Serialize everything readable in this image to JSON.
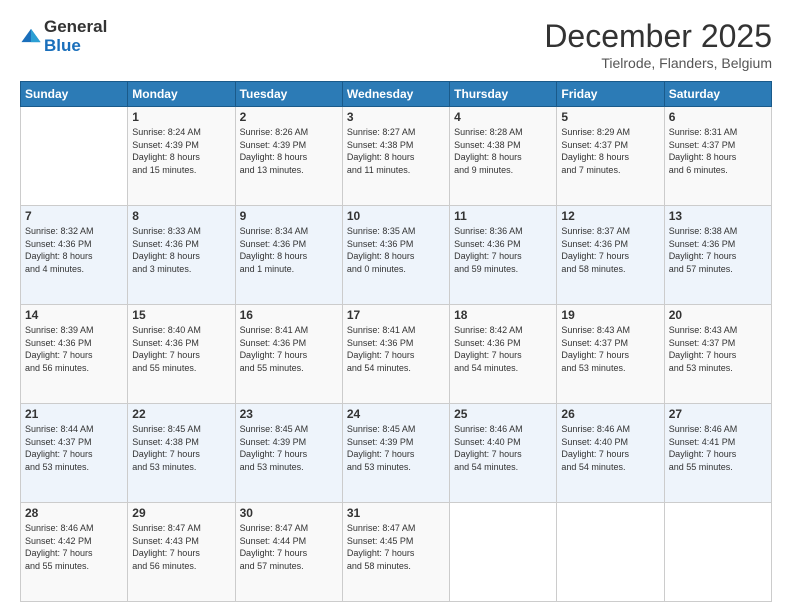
{
  "logo": {
    "general": "General",
    "blue": "Blue"
  },
  "header": {
    "month": "December 2025",
    "location": "Tielrode, Flanders, Belgium"
  },
  "days_of_week": [
    "Sunday",
    "Monday",
    "Tuesday",
    "Wednesday",
    "Thursday",
    "Friday",
    "Saturday"
  ],
  "weeks": [
    [
      {
        "day": "",
        "info": ""
      },
      {
        "day": "1",
        "info": "Sunrise: 8:24 AM\nSunset: 4:39 PM\nDaylight: 8 hours\nand 15 minutes."
      },
      {
        "day": "2",
        "info": "Sunrise: 8:26 AM\nSunset: 4:39 PM\nDaylight: 8 hours\nand 13 minutes."
      },
      {
        "day": "3",
        "info": "Sunrise: 8:27 AM\nSunset: 4:38 PM\nDaylight: 8 hours\nand 11 minutes."
      },
      {
        "day": "4",
        "info": "Sunrise: 8:28 AM\nSunset: 4:38 PM\nDaylight: 8 hours\nand 9 minutes."
      },
      {
        "day": "5",
        "info": "Sunrise: 8:29 AM\nSunset: 4:37 PM\nDaylight: 8 hours\nand 7 minutes."
      },
      {
        "day": "6",
        "info": "Sunrise: 8:31 AM\nSunset: 4:37 PM\nDaylight: 8 hours\nand 6 minutes."
      }
    ],
    [
      {
        "day": "7",
        "info": "Sunrise: 8:32 AM\nSunset: 4:36 PM\nDaylight: 8 hours\nand 4 minutes."
      },
      {
        "day": "8",
        "info": "Sunrise: 8:33 AM\nSunset: 4:36 PM\nDaylight: 8 hours\nand 3 minutes."
      },
      {
        "day": "9",
        "info": "Sunrise: 8:34 AM\nSunset: 4:36 PM\nDaylight: 8 hours\nand 1 minute."
      },
      {
        "day": "10",
        "info": "Sunrise: 8:35 AM\nSunset: 4:36 PM\nDaylight: 8 hours\nand 0 minutes."
      },
      {
        "day": "11",
        "info": "Sunrise: 8:36 AM\nSunset: 4:36 PM\nDaylight: 7 hours\nand 59 minutes."
      },
      {
        "day": "12",
        "info": "Sunrise: 8:37 AM\nSunset: 4:36 PM\nDaylight: 7 hours\nand 58 minutes."
      },
      {
        "day": "13",
        "info": "Sunrise: 8:38 AM\nSunset: 4:36 PM\nDaylight: 7 hours\nand 57 minutes."
      }
    ],
    [
      {
        "day": "14",
        "info": "Sunrise: 8:39 AM\nSunset: 4:36 PM\nDaylight: 7 hours\nand 56 minutes."
      },
      {
        "day": "15",
        "info": "Sunrise: 8:40 AM\nSunset: 4:36 PM\nDaylight: 7 hours\nand 55 minutes."
      },
      {
        "day": "16",
        "info": "Sunrise: 8:41 AM\nSunset: 4:36 PM\nDaylight: 7 hours\nand 55 minutes."
      },
      {
        "day": "17",
        "info": "Sunrise: 8:41 AM\nSunset: 4:36 PM\nDaylight: 7 hours\nand 54 minutes."
      },
      {
        "day": "18",
        "info": "Sunrise: 8:42 AM\nSunset: 4:36 PM\nDaylight: 7 hours\nand 54 minutes."
      },
      {
        "day": "19",
        "info": "Sunrise: 8:43 AM\nSunset: 4:37 PM\nDaylight: 7 hours\nand 53 minutes."
      },
      {
        "day": "20",
        "info": "Sunrise: 8:43 AM\nSunset: 4:37 PM\nDaylight: 7 hours\nand 53 minutes."
      }
    ],
    [
      {
        "day": "21",
        "info": "Sunrise: 8:44 AM\nSunset: 4:37 PM\nDaylight: 7 hours\nand 53 minutes."
      },
      {
        "day": "22",
        "info": "Sunrise: 8:45 AM\nSunset: 4:38 PM\nDaylight: 7 hours\nand 53 minutes."
      },
      {
        "day": "23",
        "info": "Sunrise: 8:45 AM\nSunset: 4:39 PM\nDaylight: 7 hours\nand 53 minutes."
      },
      {
        "day": "24",
        "info": "Sunrise: 8:45 AM\nSunset: 4:39 PM\nDaylight: 7 hours\nand 53 minutes."
      },
      {
        "day": "25",
        "info": "Sunrise: 8:46 AM\nSunset: 4:40 PM\nDaylight: 7 hours\nand 54 minutes."
      },
      {
        "day": "26",
        "info": "Sunrise: 8:46 AM\nSunset: 4:40 PM\nDaylight: 7 hours\nand 54 minutes."
      },
      {
        "day": "27",
        "info": "Sunrise: 8:46 AM\nSunset: 4:41 PM\nDaylight: 7 hours\nand 55 minutes."
      }
    ],
    [
      {
        "day": "28",
        "info": "Sunrise: 8:46 AM\nSunset: 4:42 PM\nDaylight: 7 hours\nand 55 minutes."
      },
      {
        "day": "29",
        "info": "Sunrise: 8:47 AM\nSunset: 4:43 PM\nDaylight: 7 hours\nand 56 minutes."
      },
      {
        "day": "30",
        "info": "Sunrise: 8:47 AM\nSunset: 4:44 PM\nDaylight: 7 hours\nand 57 minutes."
      },
      {
        "day": "31",
        "info": "Sunrise: 8:47 AM\nSunset: 4:45 PM\nDaylight: 7 hours\nand 58 minutes."
      },
      {
        "day": "",
        "info": ""
      },
      {
        "day": "",
        "info": ""
      },
      {
        "day": "",
        "info": ""
      }
    ]
  ]
}
